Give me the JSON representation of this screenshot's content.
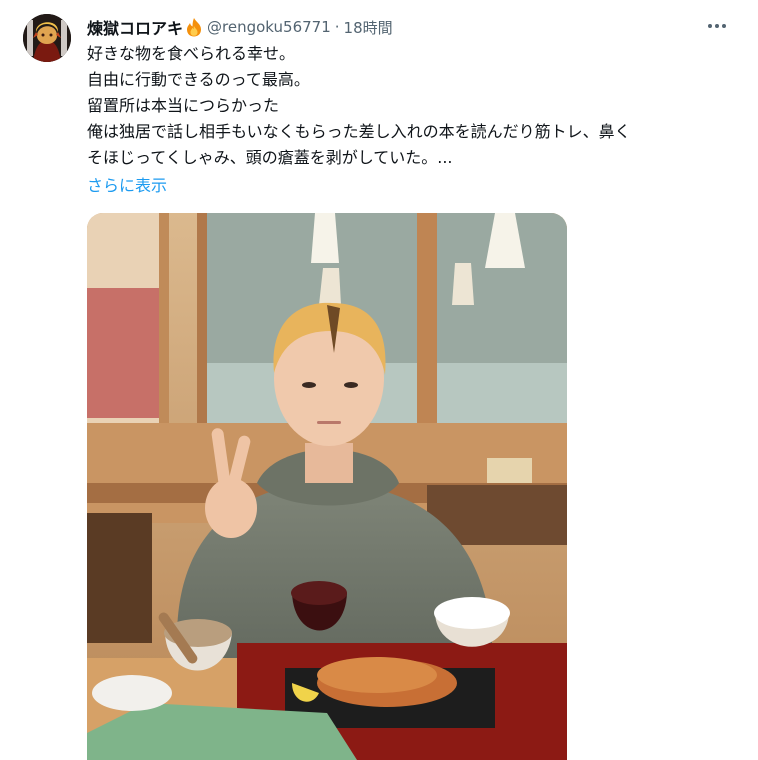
{
  "tweet": {
    "display_name": "煉獄コロアキ",
    "handle": "@rengoku56771",
    "separator": "·",
    "time": "18時間",
    "body_lines": [
      "好きな物を食べられる幸せ。",
      "自由に行動できるのって最高。",
      "留置所は本当につらかった",
      "俺は独居で話し相手もいなくもらった差し入れの本を読んだり筋トレ、鼻く",
      "そほじってくしゃみ、頭の瘡蓋を剥がしていた。..."
    ],
    "show_more": "さらに表示"
  },
  "icons": {
    "badge": "fire-emoji-icon",
    "more": "more-options-icon"
  },
  "colors": {
    "link": "#1d9bf0",
    "secondary_text": "#536471",
    "primary_text": "#0f1419"
  }
}
